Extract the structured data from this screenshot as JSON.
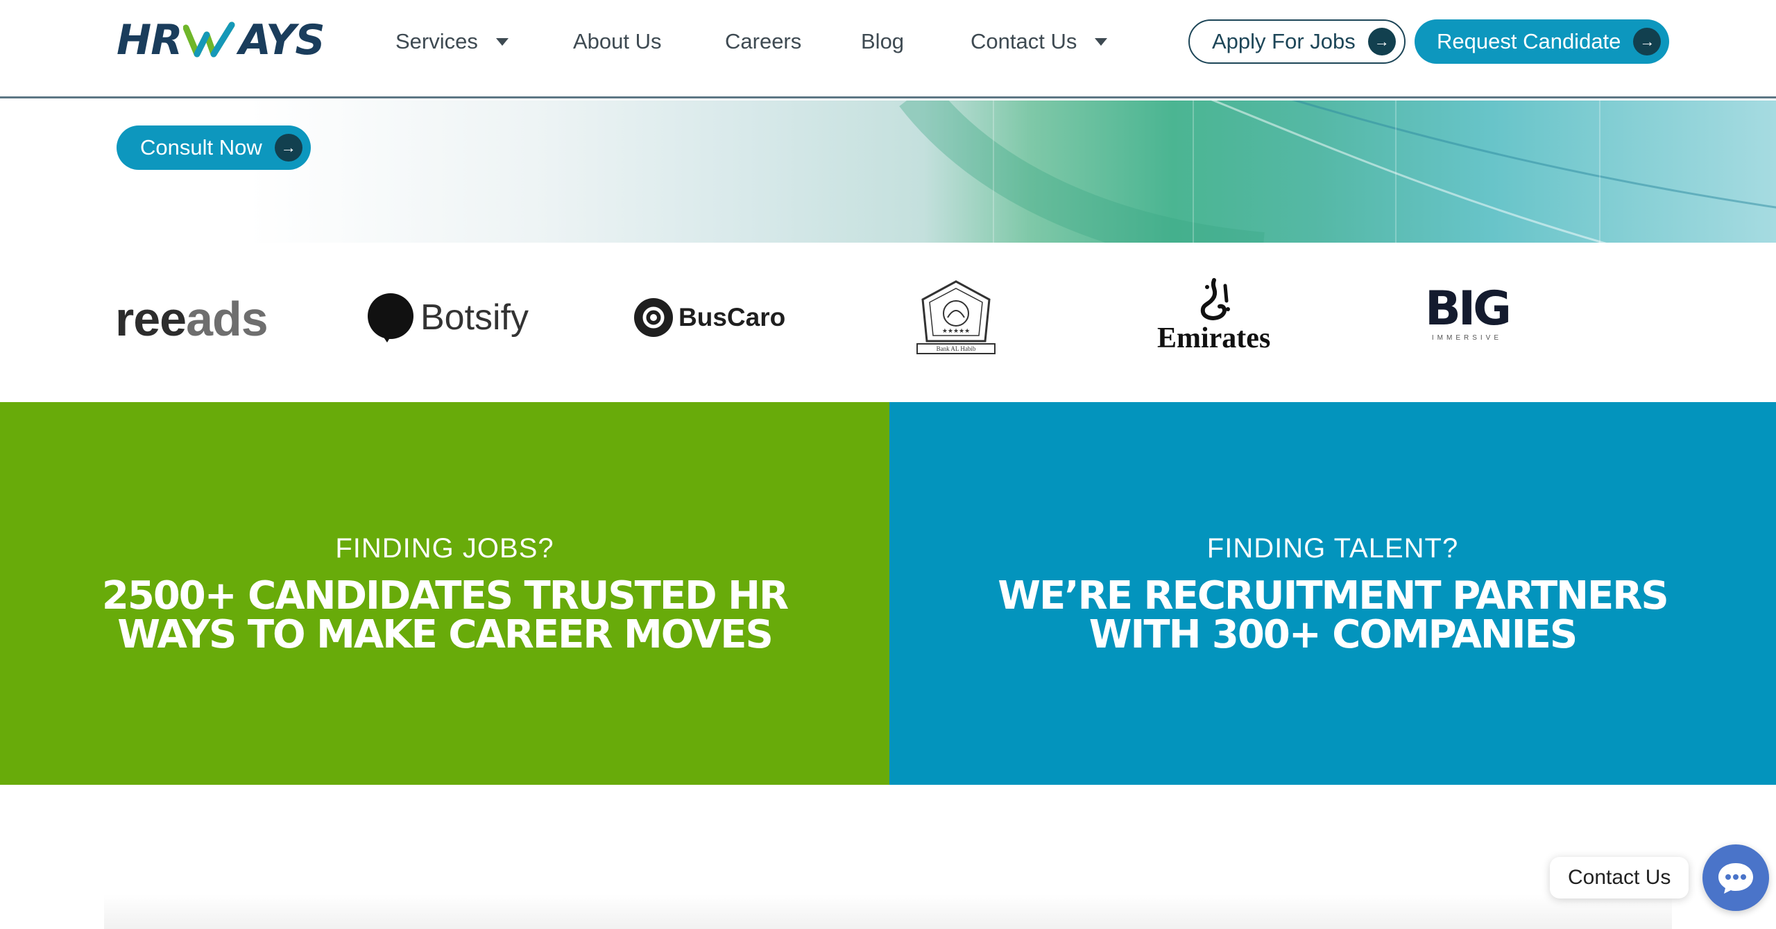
{
  "brand": {
    "logo_text_left": "HR",
    "logo_text_right": "AYS",
    "primary": "#0d97be",
    "dark": "#1a3d5c",
    "green": "#68ab0a",
    "blue": "#0394bd"
  },
  "nav": {
    "items": [
      {
        "label": "Services",
        "has_dropdown": true
      },
      {
        "label": "About Us",
        "has_dropdown": false
      },
      {
        "label": "Careers",
        "has_dropdown": false
      },
      {
        "label": "Blog",
        "has_dropdown": false
      },
      {
        "label": "Contact Us",
        "has_dropdown": true
      }
    ],
    "apply_label": "Apply For Jobs",
    "request_label": "Request Candidate"
  },
  "hero": {
    "consult_label": "Consult Now"
  },
  "clients": {
    "reeads": {
      "part1": "ree",
      "part2": "ads"
    },
    "botsify": "Botsify",
    "buscaro": "BusCaro",
    "bank_al_habib": "Bank AL Habib",
    "emirates": "Emirates",
    "big": {
      "main": "BIG",
      "sub": "IMMERSIVE"
    }
  },
  "panels": {
    "jobs": {
      "kicker": "FINDING JOBS?",
      "line1": "2500+ CANDIDATES TRUSTED HR",
      "line2": "WAYS TO MAKE CAREER MOVES"
    },
    "talent": {
      "kicker": "FINDING TALENT?",
      "line1": "WE’RE RECRUITMENT PARTNERS",
      "line2": "WITH 300+ COMPANIES"
    }
  },
  "chat": {
    "label": "Contact Us"
  },
  "icons": {
    "arrow": "arrow-right-icon",
    "caret": "caret-down-icon",
    "chat": "chat-bubble-icon"
  }
}
